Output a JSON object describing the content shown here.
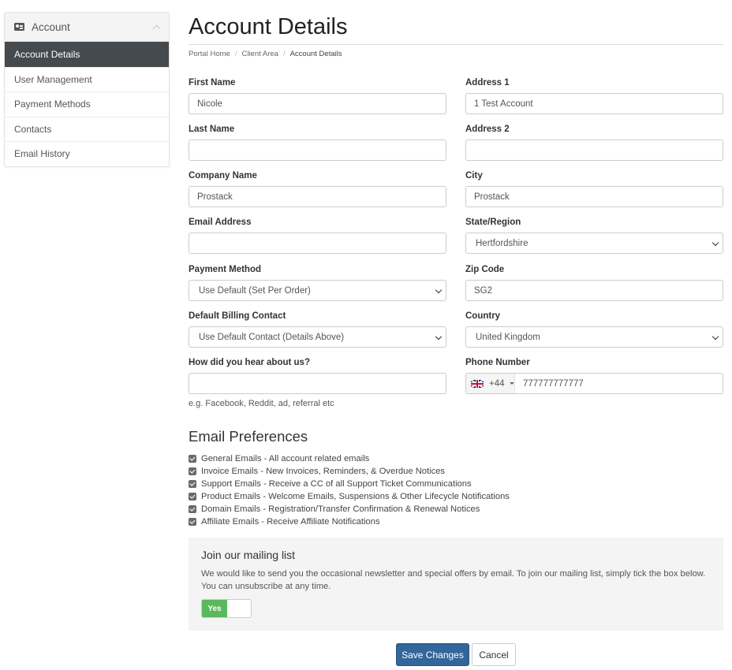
{
  "sidebar": {
    "title": "Account",
    "items": [
      {
        "label": "Account Details"
      },
      {
        "label": "User Management"
      },
      {
        "label": "Payment Methods"
      },
      {
        "label": "Contacts"
      },
      {
        "label": "Email History"
      }
    ],
    "active_index": 0
  },
  "page": {
    "title": "Account Details",
    "breadcrumb": [
      "Portal Home",
      "Client Area",
      "Account Details"
    ]
  },
  "form": {
    "first_name": {
      "label": "First Name",
      "value": "Nicole"
    },
    "last_name": {
      "label": "Last Name",
      "value": ""
    },
    "company_name": {
      "label": "Company Name",
      "value": "Prostack"
    },
    "email": {
      "label": "Email Address",
      "value": ""
    },
    "payment_method": {
      "label": "Payment Method",
      "value": "Use Default (Set Per Order)"
    },
    "billing_contact": {
      "label": "Default Billing Contact",
      "value": "Use Default Contact (Details Above)"
    },
    "hear_about": {
      "label": "How did you hear about us?",
      "value": "",
      "help": "e.g. Facebook, Reddit, ad, referral etc"
    },
    "address1": {
      "label": "Address 1",
      "value": "1 Test Account"
    },
    "address2": {
      "label": "Address 2",
      "value": ""
    },
    "city": {
      "label": "City",
      "value": "Prostack"
    },
    "state": {
      "label": "State/Region",
      "value": "Hertfordshire"
    },
    "zip": {
      "label": "Zip Code",
      "value": "SG2"
    },
    "country": {
      "label": "Country",
      "value": "United Kingdom"
    },
    "phone": {
      "label": "Phone Number",
      "country_code": "+44",
      "flag_icon": "uk-flag-icon",
      "value": "777777777777"
    }
  },
  "email_prefs": {
    "title": "Email Preferences",
    "items": [
      {
        "label": "General Emails - All account related emails",
        "checked": true
      },
      {
        "label": "Invoice Emails - New Invoices, Reminders, & Overdue Notices",
        "checked": true
      },
      {
        "label": "Support Emails - Receive a CC of all Support Ticket Communications",
        "checked": true
      },
      {
        "label": "Product Emails - Welcome Emails, Suspensions & Other Lifecycle Notifications",
        "checked": true
      },
      {
        "label": "Domain Emails - Registration/Transfer Confirmation & Renewal Notices",
        "checked": true
      },
      {
        "label": "Affiliate Emails - Receive Affiliate Notifications",
        "checked": true
      }
    ]
  },
  "mailing": {
    "title": "Join our mailing list",
    "description": "We would like to send you the occasional newsletter and special offers by email. To join our mailing list, simply tick the box below. You can unsubscribe at any time.",
    "toggle_label": "Yes",
    "toggle_on": true
  },
  "buttons": {
    "save": "Save Changes",
    "cancel": "Cancel"
  },
  "colors": {
    "sidebar_active": "#454a4e",
    "primary_button": "#336699",
    "toggle_on": "#5cb85c",
    "mailing_bg": "#f4f4f4"
  }
}
